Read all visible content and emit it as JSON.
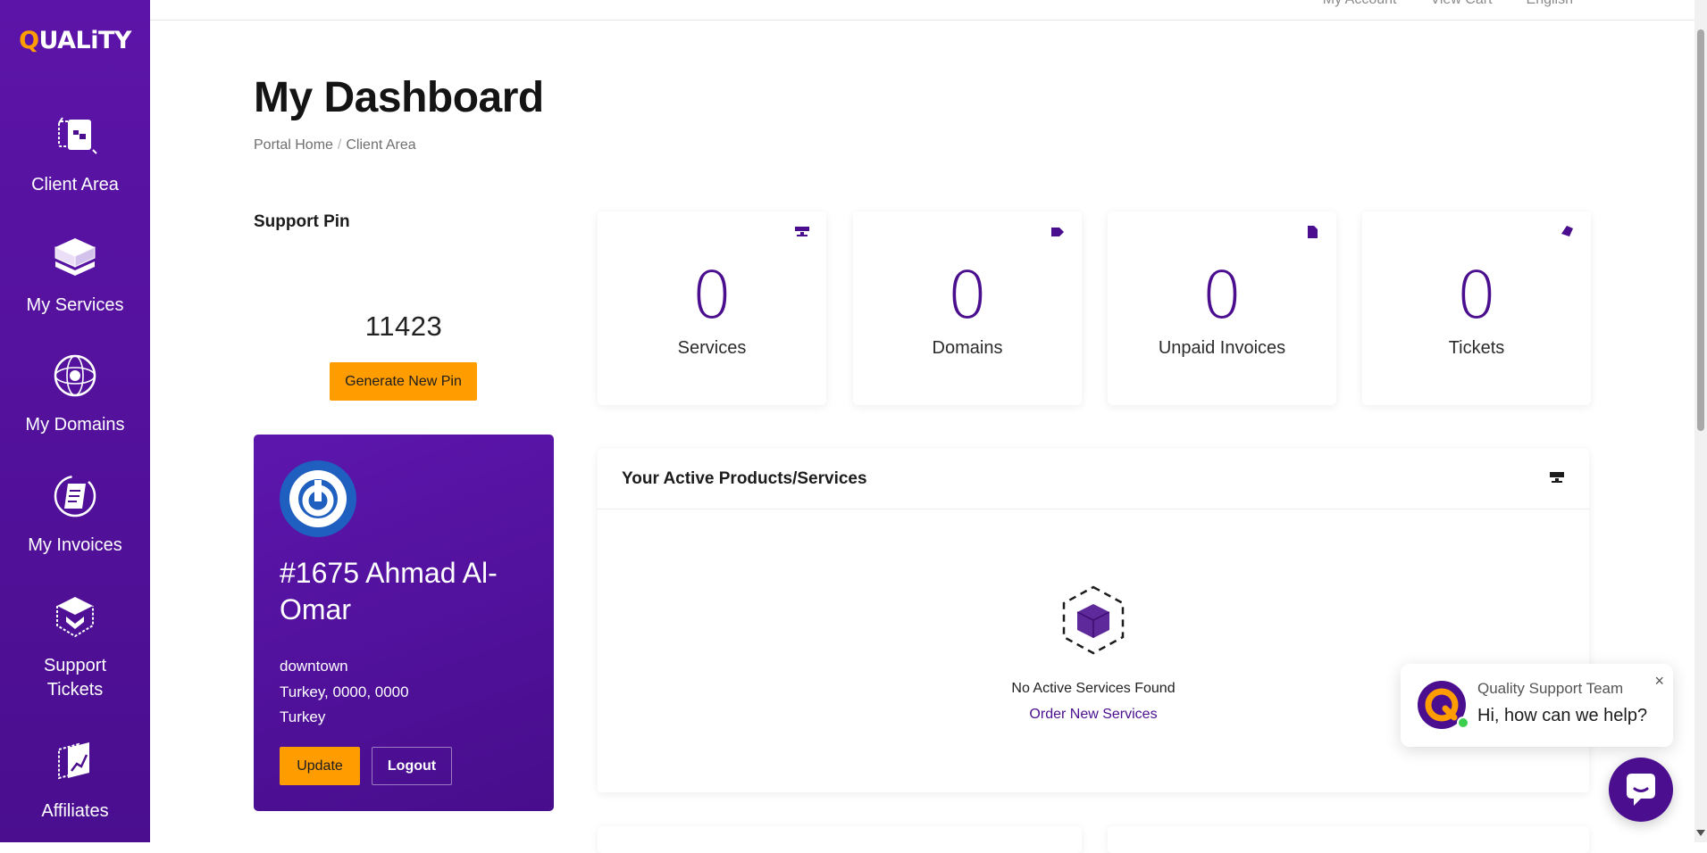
{
  "brand": {
    "logo_prefix": "Q",
    "logo_text": "UALiTY",
    "accent": "#ff9d00",
    "primary": "#4a0e8f"
  },
  "topbar": {
    "items": [
      "My Account",
      "View Cart",
      "English"
    ]
  },
  "sidebar": {
    "items": [
      {
        "label": "Client Area",
        "icon": "client-area-icon"
      },
      {
        "label": "My Services",
        "icon": "services-box-icon"
      },
      {
        "label": "My Domains",
        "icon": "globe-icon"
      },
      {
        "label": "My Invoices",
        "icon": "invoice-icon"
      },
      {
        "label": "Support\nTickets",
        "icon": "ticket-box-icon"
      },
      {
        "label": "Affiliates",
        "icon": "affiliates-chart-icon"
      }
    ]
  },
  "header": {
    "title": "My Dashboard",
    "breadcrumb": [
      "Portal Home",
      "Client Area"
    ]
  },
  "support_pin": {
    "title": "Support Pin",
    "value": "11423",
    "button": "Generate New Pin"
  },
  "profile": {
    "name": "#1675 Ahmad Al-Omar",
    "address_line1": "downtown",
    "address_line2": "Turkey, 0000, 0000",
    "address_line3": "Turkey",
    "update_label": "Update",
    "logout_label": "Logout"
  },
  "stats": [
    {
      "value": "0",
      "label": "Services",
      "icon": "server-icon"
    },
    {
      "value": "0",
      "label": "Domains",
      "icon": "tag-icon"
    },
    {
      "value": "0",
      "label": "Unpaid Invoices",
      "icon": "document-icon"
    },
    {
      "value": "0",
      "label": "Tickets",
      "icon": "ticket-icon"
    }
  ],
  "products_panel": {
    "title": "Your Active Products/Services",
    "empty_text": "No Active Services Found",
    "order_link": "Order New Services"
  },
  "chat": {
    "team_name": "Quality Support Team",
    "message": "Hi, how can we help?",
    "close": "×"
  }
}
